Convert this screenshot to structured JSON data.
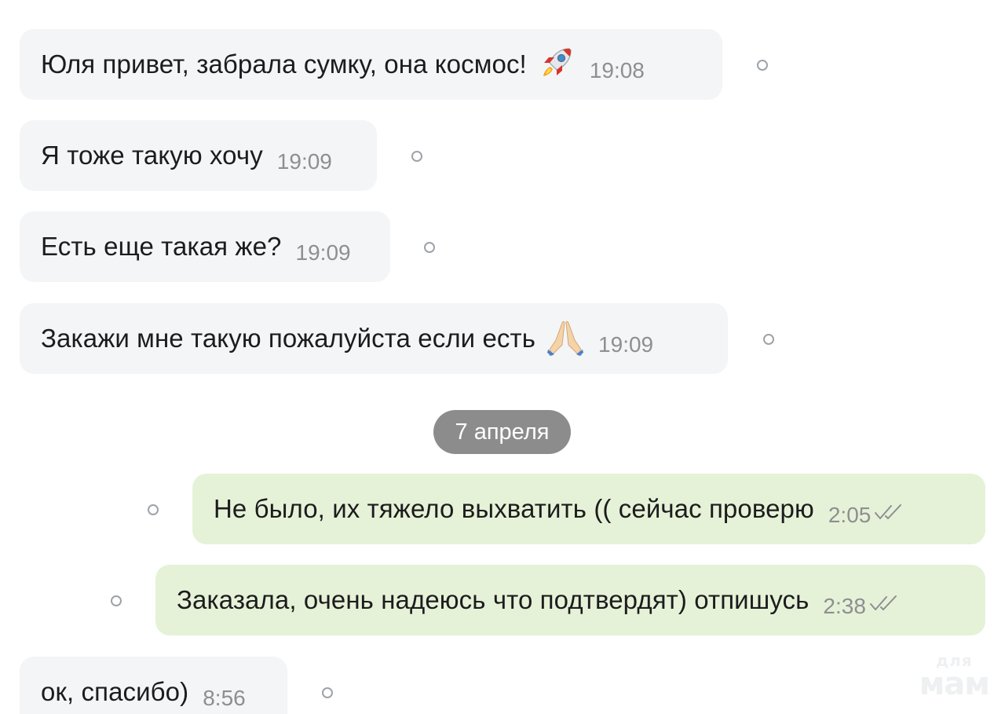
{
  "messages": [
    {
      "direction": "incoming",
      "text": "Юля привет, забрала сумку, она космос!",
      "emoji": "rocket",
      "time": "19:08"
    },
    {
      "direction": "incoming",
      "text": "Я тоже такую хочу",
      "time": "19:09"
    },
    {
      "direction": "incoming",
      "text": "Есть еще такая же?",
      "time": "19:09"
    },
    {
      "direction": "incoming",
      "text": "Закажи мне такую пожалуйста если есть",
      "emoji": "folded-hands",
      "time": "19:09"
    },
    {
      "direction": "outgoing",
      "text": "Не было, их тяжело выхватить (( сейчас проверю",
      "time": "2:05",
      "status": "read"
    },
    {
      "direction": "outgoing",
      "text": "Заказала, очень надеюсь что подтвердят) отпишусь",
      "time": "2:38",
      "status": "read"
    },
    {
      "direction": "incoming",
      "text": "ок, спасибо)",
      "time": "8:56"
    }
  ],
  "date_separator": "7 апреля",
  "watermark": {
    "top": "для",
    "bottom": "мам"
  },
  "colors": {
    "incoming_bubble": "#f4f5f7",
    "outgoing_bubble": "#e6f2d7",
    "date_pill": "#8c8c8c",
    "time_text": "#8e8e93",
    "check_marks": "#8e8e93"
  }
}
